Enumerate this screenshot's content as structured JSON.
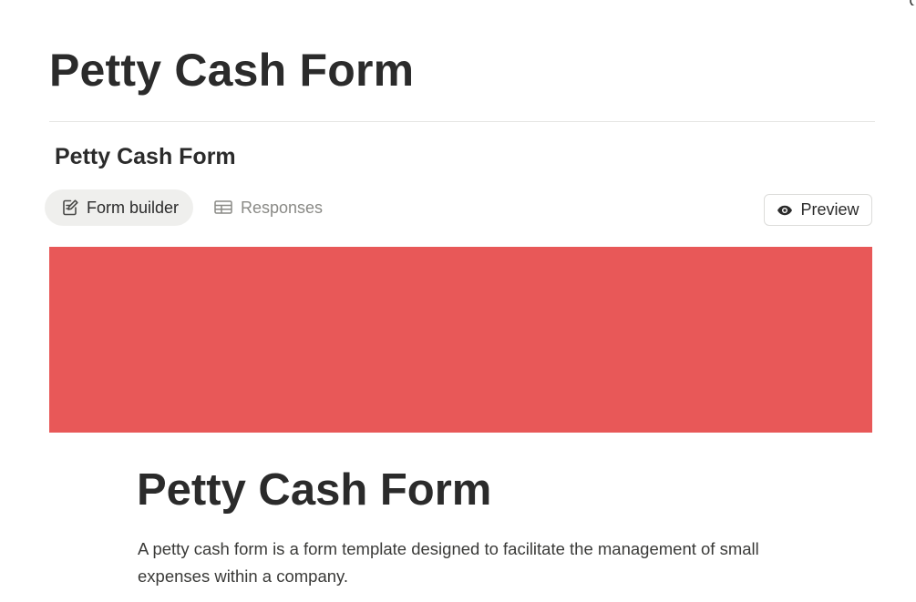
{
  "page": {
    "title": "Petty Cash Form"
  },
  "form": {
    "title": "Petty Cash Form",
    "tabs": [
      {
        "label": "Form builder",
        "icon": "edit-form-icon",
        "active": true
      },
      {
        "label": "Responses",
        "icon": "table-icon",
        "active": false
      }
    ],
    "preview_label": "Preview",
    "preview_icon": "eye-icon",
    "cover_color": "#e85858"
  },
  "document": {
    "title": "Petty Cash Form",
    "description": "A petty cash form is a form template designed to facilitate the management of small expenses within a company."
  }
}
